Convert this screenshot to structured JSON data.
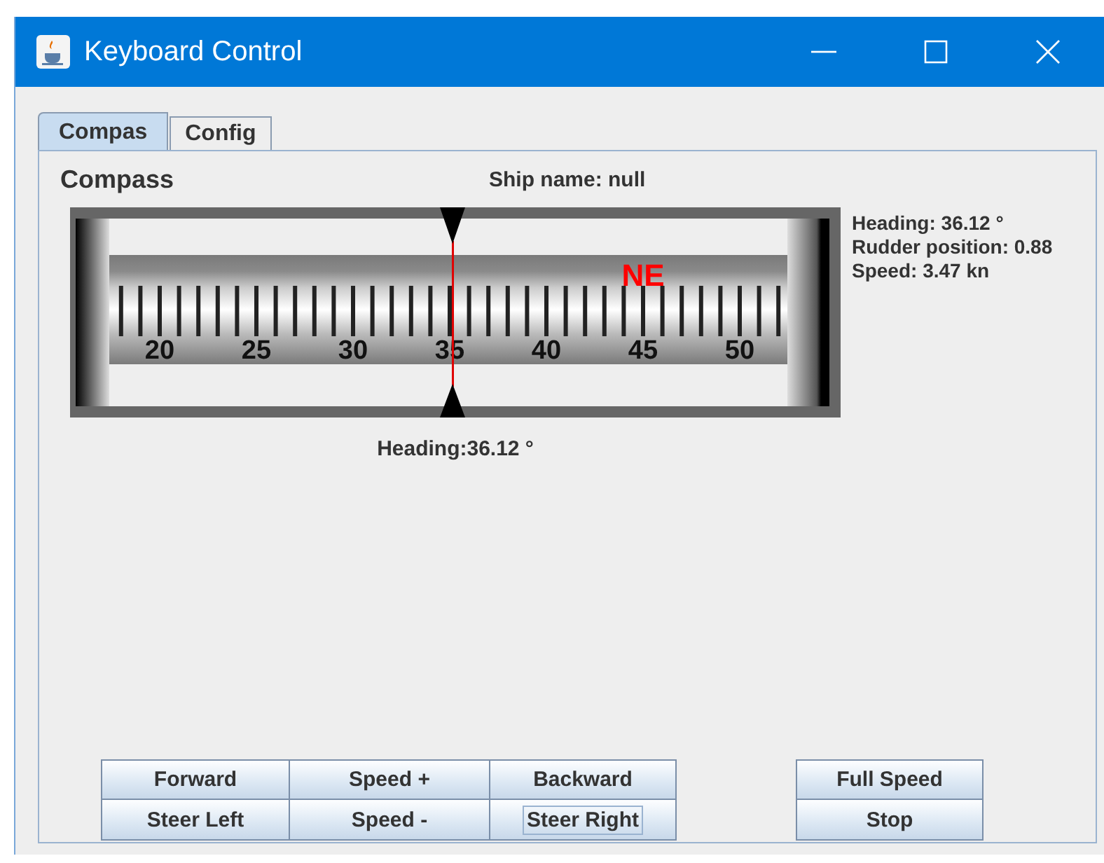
{
  "window": {
    "title": "Keyboard Control"
  },
  "tabs": [
    {
      "label": "Compas",
      "selected": true
    },
    {
      "label": "Config",
      "selected": false
    }
  ],
  "compass": {
    "title": "Compass",
    "ship_name": "Ship name: null",
    "direction": "NE",
    "scale_labels": [
      "20",
      "25",
      "30",
      "35",
      "40",
      "45",
      "50"
    ],
    "heading_caption": "Heading:36.12 °"
  },
  "readouts": [
    "Heading: 36.12 °",
    "Rudder position: 0.88",
    "Speed: 3.47 kn"
  ],
  "drive_buttons": [
    {
      "label": "Forward",
      "focused": false
    },
    {
      "label": "Speed +",
      "focused": false
    },
    {
      "label": "Backward",
      "focused": false
    },
    {
      "label": "Steer Left",
      "focused": false
    },
    {
      "label": "Speed -",
      "focused": false
    },
    {
      "label": "Steer Right",
      "focused": true
    }
  ],
  "speed_buttons": [
    {
      "label": "Full Speed",
      "focused": false
    },
    {
      "label": "Stop",
      "focused": false
    }
  ]
}
